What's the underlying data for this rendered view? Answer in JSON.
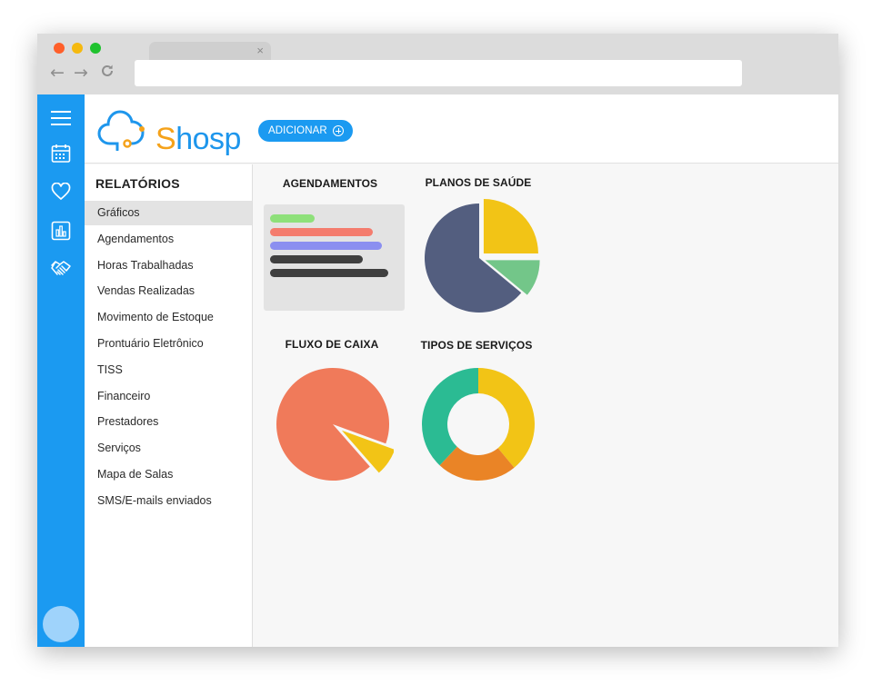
{
  "browser": {
    "tab_close": "×",
    "back": "←",
    "forward": "→",
    "reload": "C",
    "url": ""
  },
  "rail": {
    "icons": [
      "menu-icon",
      "calendar-icon",
      "heart-icon",
      "bar-chart-icon",
      "handshake-icon"
    ]
  },
  "app": {
    "logo_text_first": "S",
    "logo_text_rest": "hosp",
    "add_button": "ADICIONAR",
    "accent": "#1b9af1",
    "logo_orange": "#f5a21a"
  },
  "sidebar": {
    "title": "RELATÓRIOS",
    "items": [
      {
        "label": "Gráficos",
        "active": true
      },
      {
        "label": "Agendamentos"
      },
      {
        "label": "Horas Trabalhadas"
      },
      {
        "label": "Vendas Realizadas"
      },
      {
        "label": "Movimento de Estoque"
      },
      {
        "label": "Prontuário Eletrônico"
      },
      {
        "label": "TISS"
      },
      {
        "label": "Financeiro"
      },
      {
        "label": "Prestadores"
      },
      {
        "label": "Serviços"
      },
      {
        "label": "Mapa de Salas"
      },
      {
        "label": "SMS/E-mails enviados"
      }
    ]
  },
  "panels": {
    "agendamentos": "AGENDAMENTOS",
    "planos": "PLANOS DE SAÚDE",
    "fluxo": "FLUXO DE CAIXA",
    "tipos": "TIPOS DE SERVIÇOS"
  },
  "chart_data": [
    {
      "type": "bar",
      "orientation": "horizontal",
      "title": "AGENDAMENTOS",
      "values": [
        0.35,
        0.8,
        0.87,
        0.72,
        0.92
      ],
      "colors": [
        "#8ee07a",
        "#f47c6e",
        "#8b8ff0",
        "#3f3f3f",
        "#3f3f3f"
      ]
    },
    {
      "type": "pie",
      "title": "PLANOS DE SAÚDE",
      "values": [
        0.25,
        0.11,
        0.64
      ],
      "colors": [
        "#f2c416",
        "#73c689",
        "#535e7f"
      ]
    },
    {
      "type": "pie",
      "title": "FLUXO DE CAIXA",
      "values": [
        0.08,
        0.92
      ],
      "colors": [
        "#f2c416",
        "#f07a5a"
      ]
    },
    {
      "type": "pie",
      "donut": true,
      "title": "TIPOS DE SERVIÇOS",
      "values": [
        0.39,
        0.23,
        0.38
      ],
      "colors": [
        "#f2c416",
        "#ea8426",
        "#2bbb93"
      ]
    }
  ]
}
